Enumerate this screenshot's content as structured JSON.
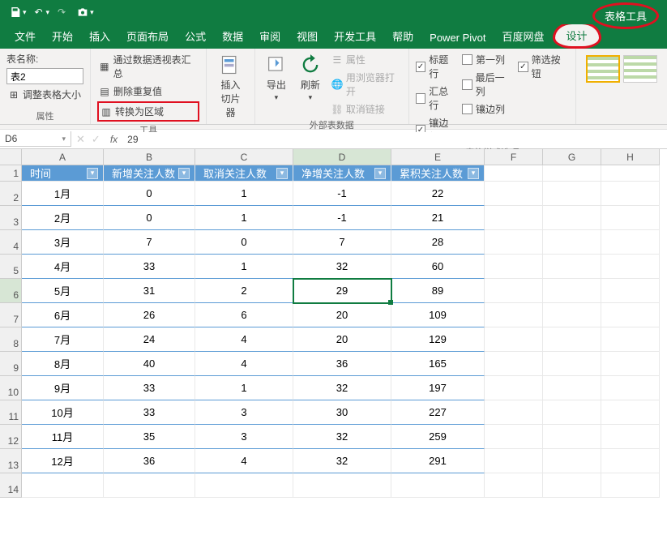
{
  "qat": {
    "save": "💾",
    "undo": "↶",
    "redo": "↷",
    "camera": "📷"
  },
  "context_tab": "表格工具",
  "tabs": [
    "文件",
    "开始",
    "插入",
    "页面布局",
    "公式",
    "数据",
    "审阅",
    "视图",
    "开发工具",
    "帮助",
    "Power Pivot",
    "百度网盘"
  ],
  "design_tab": "设计",
  "ribbon": {
    "props": {
      "name_label": "表名称:",
      "table_name": "表2",
      "resize": "调整表格大小",
      "group": "属性"
    },
    "tools": {
      "pivot": "通过数据透视表汇总",
      "dedupe": "删除重复值",
      "convert": "转换为区域",
      "group": "工具"
    },
    "slicer": {
      "label": "插入\n切片器"
    },
    "ext": {
      "export": "导出",
      "refresh": "刷新",
      "props": "属性",
      "browser": "用浏览器打开",
      "unlink": "取消链接",
      "group": "外部表数据"
    },
    "styleopt": {
      "header": "标题行",
      "total": "汇总行",
      "banded_row": "镶边行",
      "first_col": "第一列",
      "last_col": "最后一列",
      "banded_col": "镶边列",
      "filter": "筛选按钮",
      "group": "表格样式选项",
      "checks": {
        "header": true,
        "total": false,
        "banded_row": true,
        "first_col": false,
        "last_col": false,
        "banded_col": false,
        "filter": true
      }
    }
  },
  "namebox": "D6",
  "formula_value": "29",
  "columns": [
    "A",
    "B",
    "C",
    "D",
    "E",
    "F",
    "G",
    "H"
  ],
  "active_col": "D",
  "active_row": 6,
  "chart_data": {
    "type": "table",
    "headers": [
      "时间",
      "新增关注人数",
      "取消关注人数",
      "净增关注人数",
      "累积关注人数"
    ],
    "rows": [
      [
        "1月",
        0,
        1,
        -1,
        22
      ],
      [
        "2月",
        0,
        1,
        -1,
        21
      ],
      [
        "3月",
        7,
        0,
        7,
        28
      ],
      [
        "4月",
        33,
        1,
        32,
        60
      ],
      [
        "5月",
        31,
        2,
        29,
        89
      ],
      [
        "6月",
        26,
        6,
        20,
        109
      ],
      [
        "7月",
        24,
        4,
        20,
        129
      ],
      [
        "8月",
        40,
        4,
        36,
        165
      ],
      [
        "9月",
        33,
        1,
        32,
        197
      ],
      [
        "10月",
        33,
        3,
        30,
        227
      ],
      [
        "11月",
        35,
        3,
        32,
        259
      ],
      [
        "12月",
        36,
        4,
        32,
        291
      ]
    ]
  }
}
